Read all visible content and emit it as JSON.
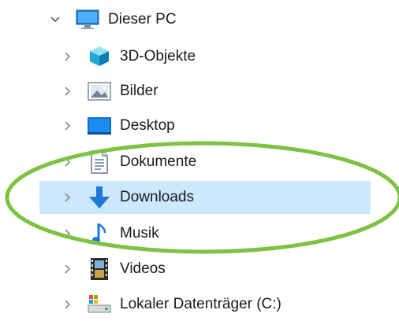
{
  "colors": {
    "selection": "#cce8ff",
    "annotation_ring": "#7dc242",
    "text": "#1a1a1a",
    "chevron": "#8a8a8a"
  },
  "tree": {
    "root": {
      "label": "Dieser PC",
      "icon": "monitor-icon",
      "expanded": true
    },
    "items": [
      {
        "label": "3D-Objekte",
        "icon": "cube-3d-icon",
        "selected": false
      },
      {
        "label": "Bilder",
        "icon": "pictures-icon",
        "selected": false
      },
      {
        "label": "Desktop",
        "icon": "desktop-icon",
        "selected": false
      },
      {
        "label": "Dokumente",
        "icon": "document-icon",
        "selected": false
      },
      {
        "label": "Downloads",
        "icon": "download-arrow-icon",
        "selected": true
      },
      {
        "label": "Musik",
        "icon": "music-note-icon",
        "selected": false
      },
      {
        "label": "Videos",
        "icon": "film-icon",
        "selected": false
      },
      {
        "label": "Lokaler Datenträger (C:)",
        "icon": "local-disk-icon",
        "selected": false
      }
    ]
  }
}
